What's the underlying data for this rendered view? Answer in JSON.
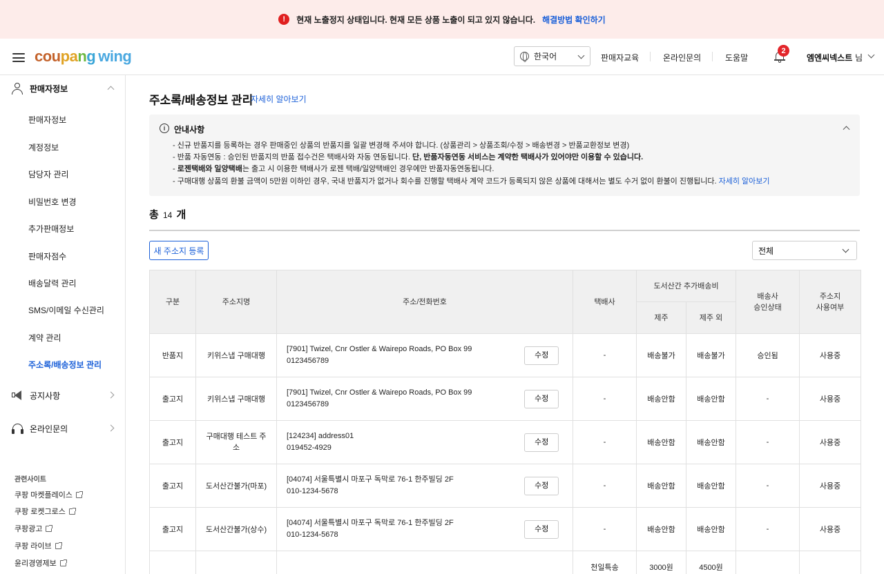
{
  "banner": {
    "icon": "alert-icon",
    "message": "현재 노출정지 상태입니다. 현재 모든 상품 노출이 되고 있지 않습니다.",
    "link": "해결방법 확인하기"
  },
  "header": {
    "logo_parts": [
      "cou",
      "pa",
      "n",
      "g"
    ],
    "logo_wing": "wing",
    "language": "한국어",
    "nav": [
      "판매자교육",
      "온라인문의",
      "도움말"
    ],
    "notification_count": "2",
    "user_name": "엠엔씨넥스트",
    "user_suffix": "님"
  },
  "sidebar": {
    "group_seller": "판매자정보",
    "items": [
      "판매자정보",
      "계정정보",
      "담당자 관리",
      "비밀번호 변경",
      "추가판매정보",
      "판매자점수",
      "배송달력 관리",
      "SMS/이메일 수신관리",
      "계약 관리",
      "주소록/배송정보 관리"
    ],
    "group_notice": "공지사항",
    "group_inquiry": "온라인문의",
    "related_title": "관련사이트",
    "related_links": [
      "쿠팡 마켓플레이스",
      "쿠팡 로켓그로스",
      "쿠팡광고",
      "쿠팡 라이브",
      "윤리경영제보"
    ]
  },
  "main": {
    "title": "주소록/배송정보 관리",
    "title_link": "자세히 알아보기",
    "notice": {
      "title": "안내사항",
      "line1": "- 신규 반품지를 등록하는 경우 판매중인 상품의 반품지를 일괄 변경해 주셔야 합니다. (상품관리 > 상품조회/수정 > 배송변경 > 반품교환정보 변경)",
      "line2_a": "- 반품 자동연동 : 승인된 반품지의 반품 접수건은 택배사와 자동 연동됩니다.",
      "line2_b": "단, 반품자동연동 서비스는 계약한 택배사가 있어야만 이용할 수 있습니다.",
      "line3_a": "- ",
      "line3_b": "로젠택배와 일양택배",
      "line3_c": "는 출고 시 이용한 택배사가 로젠 택배/일양택배인 경우에만 반품자동연동됩니다.",
      "line4": "- 구매대행 상품의 환불 금액이 5만원 이하인 경우, 국내 반품지가 없거나 회수를 진행할 택배사 계약 코드가 등록되지 않은 상품에 대해서는 별도 수거 없이 환불이 진행됩니다.",
      "line4_link": "자세히 알아보기"
    },
    "total_prefix": "총",
    "total_count": "14",
    "total_suffix": "개",
    "new_button": "새 주소지 등록",
    "filter_value": "전체",
    "table": {
      "headers": {
        "type": "구분",
        "name": "주소지명",
        "address": "주소/전화번호",
        "courier": "택배사",
        "island_fee": "도서산간 추가배송비",
        "jeju": "제주",
        "non_jeju": "제주 외",
        "approval_1": "배송사",
        "approval_2": "승인상태",
        "usage_1": "주소지",
        "usage_2": "사용여부"
      },
      "edit_label": "수정",
      "rows": [
        {
          "type": "반품지",
          "name": "키위스냅 구매대행",
          "address": "[7901] Twizel, Cnr Ostler & Wairepo Roads, PO Box 99",
          "phone": "0123456789",
          "courier": "-",
          "jeju": "배송불가",
          "non_jeju": "배송불가",
          "approval": "승인됨",
          "usage": "사용중"
        },
        {
          "type": "출고지",
          "name": "키위스냅 구매대행",
          "address": "[7901] Twizel, Cnr Ostler & Wairepo Roads, PO Box 99",
          "phone": "0123456789",
          "courier": "-",
          "jeju": "배송안함",
          "non_jeju": "배송안함",
          "approval": "-",
          "usage": "사용중"
        },
        {
          "type": "출고지",
          "name": "구매대행 테스트 주소",
          "address": "[124234] address01",
          "phone": "019452-4929",
          "courier": "-",
          "jeju": "배송안함",
          "non_jeju": "배송안함",
          "approval": "-",
          "usage": "사용중"
        },
        {
          "type": "출고지",
          "name": "도서산간불가(마포)",
          "address": "[04074] 서울특별시 마포구 독막로 76-1 한주빌딩 2F",
          "phone": "010-1234-5678",
          "courier": "-",
          "jeju": "배송안함",
          "non_jeju": "배송안함",
          "approval": "-",
          "usage": "사용중"
        },
        {
          "type": "출고지",
          "name": "도서산간불가(상수)",
          "address": "[04074] 서울특별시 마포구 독막로 76-1 한주빌딩 2F",
          "phone": "010-1234-5678",
          "courier": "-",
          "jeju": "배송안함",
          "non_jeju": "배송안함",
          "approval": "-",
          "usage": "사용중"
        }
      ],
      "partial_row": {
        "courier": "천일특송",
        "jeju": "3000원",
        "non_jeju": "4500원"
      }
    }
  }
}
